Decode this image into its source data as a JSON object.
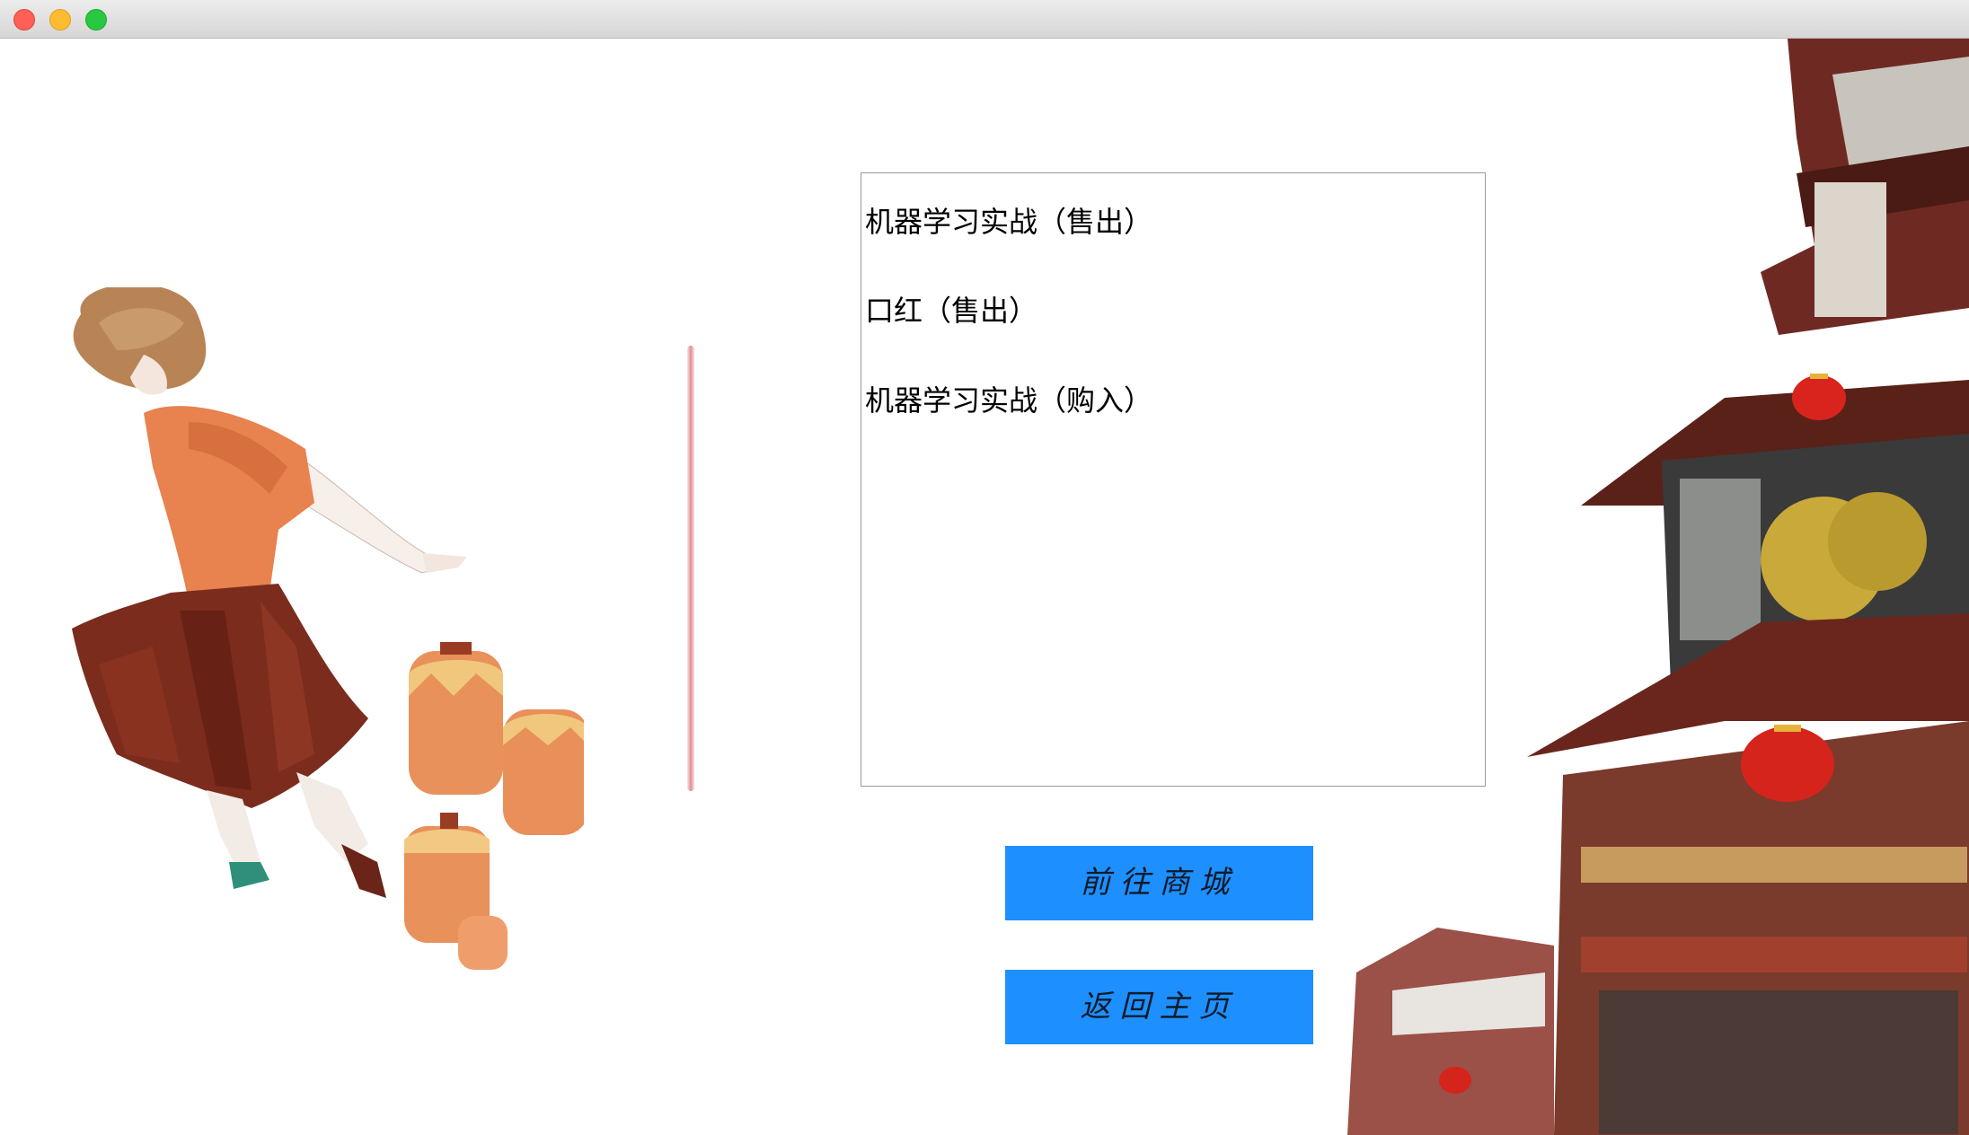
{
  "window": {
    "controls": [
      "close",
      "minimize",
      "maximize"
    ]
  },
  "records": {
    "items": [
      {
        "label": "机器学习实战（售出）"
      },
      {
        "label": "口红（售出）"
      },
      {
        "label": "机器学习实战（购入）"
      }
    ]
  },
  "buttons": {
    "go_mall": "前往商城",
    "back_home": "返回主页"
  },
  "colors": {
    "button_bg": "#1e8ffe",
    "divider": "#e08f8f",
    "list_border": "#9a9a9a"
  },
  "icons": {
    "close": "close-dot-icon",
    "minimize": "minimize-dot-icon",
    "maximize": "maximize-dot-icon"
  }
}
